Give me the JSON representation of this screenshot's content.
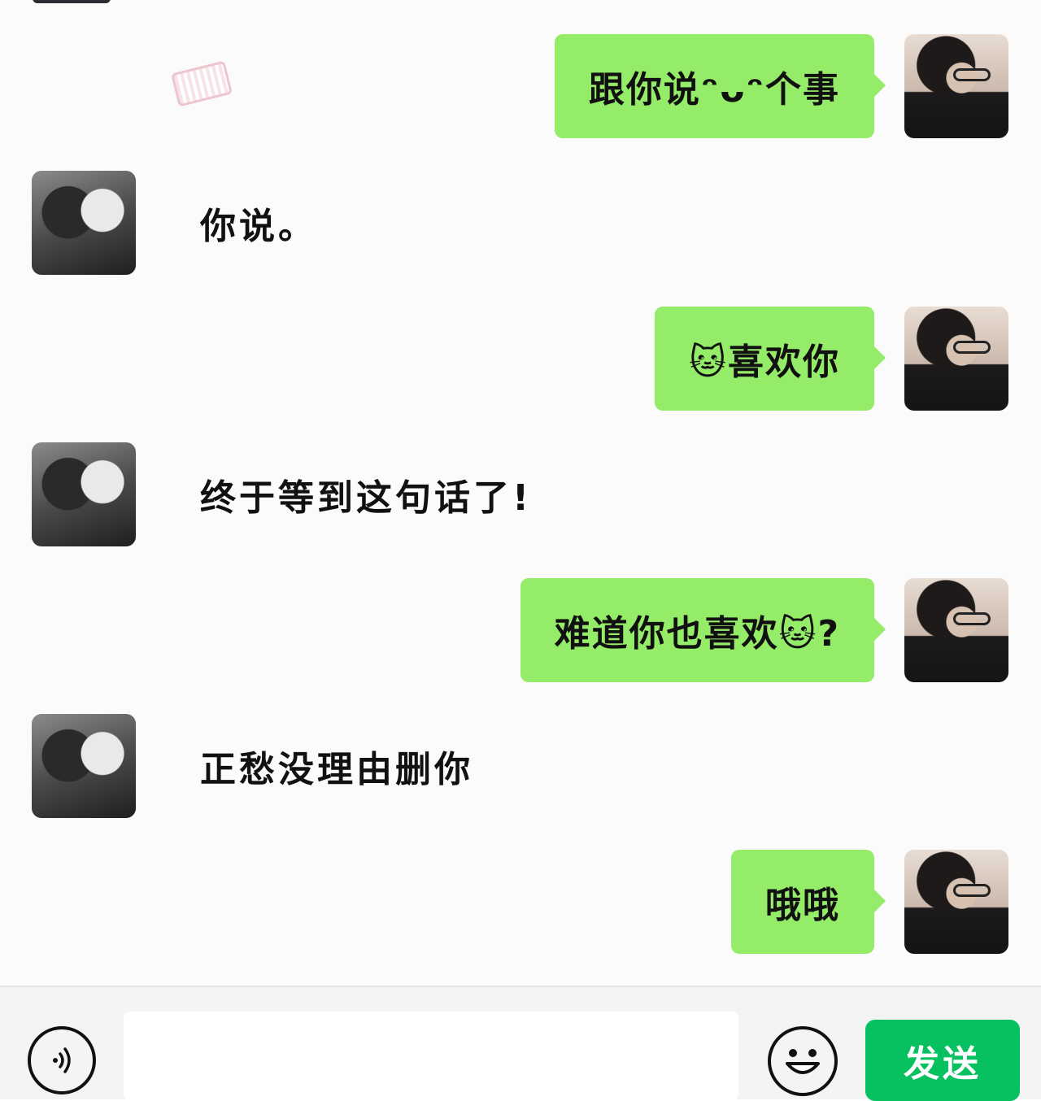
{
  "messages": [
    {
      "sender": "me",
      "text": "跟你说ᵔᴗᵔ个事"
    },
    {
      "sender": "them",
      "text": "你说。"
    },
    {
      "sender": "me",
      "text": "🐱喜欢你"
    },
    {
      "sender": "them",
      "text": "终于等到这句话了!"
    },
    {
      "sender": "me",
      "text": "难道你也喜欢🐱?"
    },
    {
      "sender": "them",
      "text": "正愁没理由删你"
    },
    {
      "sender": "me",
      "text": "哦哦"
    }
  ],
  "input_bar": {
    "voice_icon": "voice-icon",
    "input_value": "",
    "emoji_icon": "emoji-smile-icon",
    "send_label": "发送"
  },
  "colors": {
    "my_bubble": "#95ec69",
    "send_button": "#07c160",
    "chat_background": "#fbfbfb"
  }
}
